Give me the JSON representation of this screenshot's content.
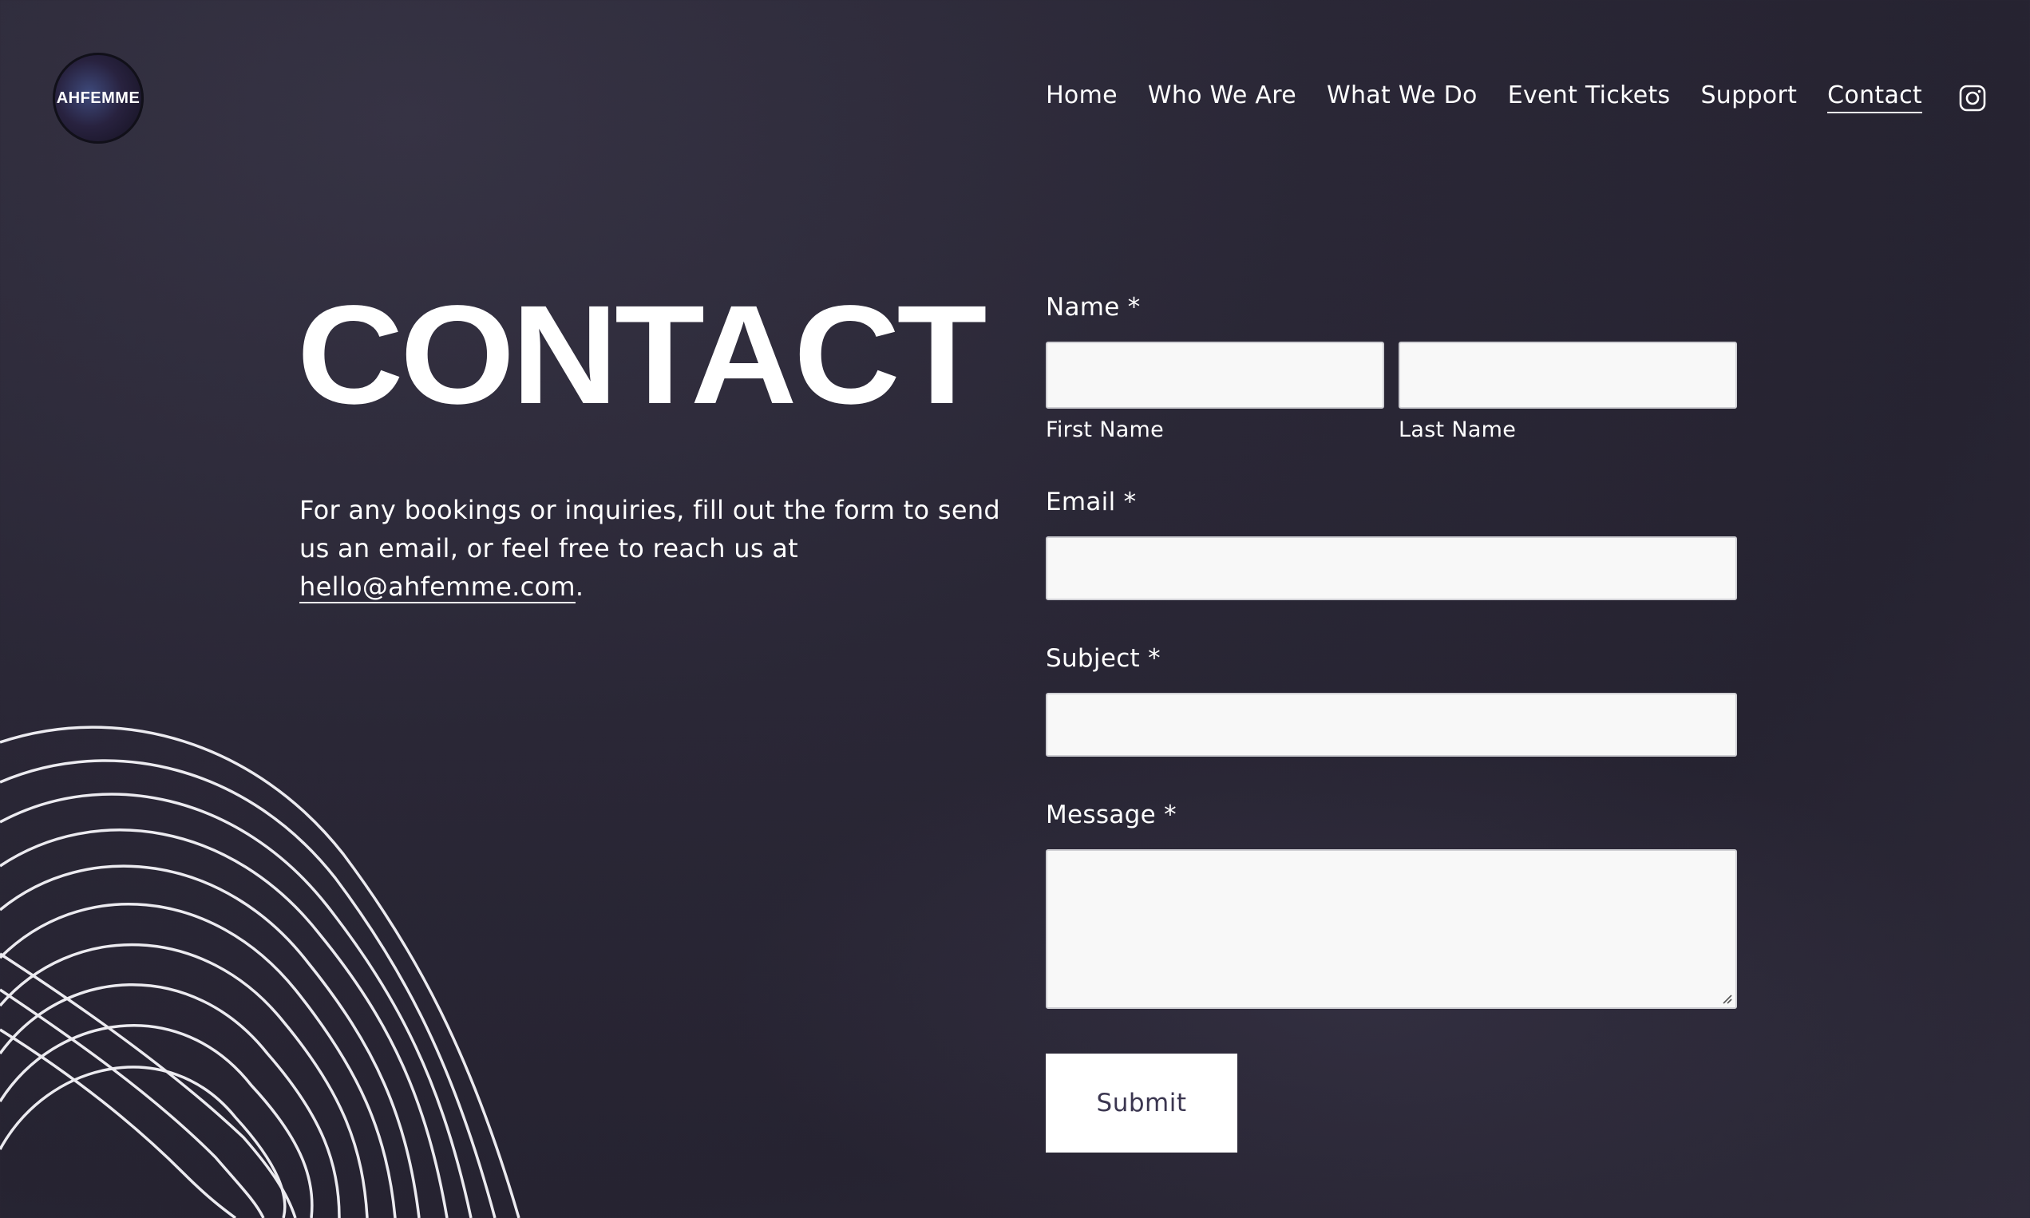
{
  "brand": {
    "logo_text": "AHFEMME"
  },
  "nav": {
    "items": [
      {
        "label": "Home"
      },
      {
        "label": "Who We Are"
      },
      {
        "label": "What We Do"
      },
      {
        "label": "Event Tickets"
      },
      {
        "label": "Support"
      },
      {
        "label": "Contact",
        "active": true
      }
    ],
    "social_icon": "instagram-icon"
  },
  "main": {
    "title": "CONTACT",
    "intro_text": "For any bookings or inquiries, fill out the form to send us an email, or feel free to reach us at ",
    "email_link": "hello@ahfemme.com",
    "intro_suffix": "."
  },
  "form": {
    "name_label": "Name *",
    "first_name_label": "First Name",
    "last_name_label": "Last Name",
    "first_name_value": "",
    "last_name_value": "",
    "email_label": "Email *",
    "email_value": "",
    "subject_label": "Subject *",
    "subject_value": "",
    "message_label": "Message *",
    "message_value": "",
    "submit_label": "Submit"
  },
  "colors": {
    "background": "#2a2736",
    "text": "#ffffff",
    "input_bg": "#f8f8f8",
    "submit_text": "#3b3650"
  }
}
